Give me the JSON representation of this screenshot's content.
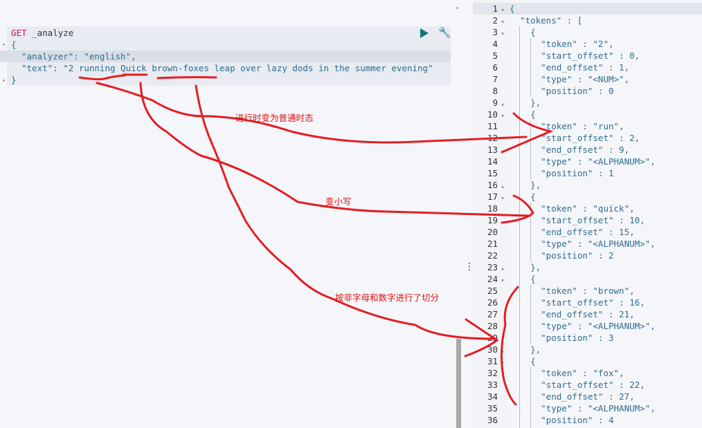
{
  "request": {
    "method": "GET",
    "endpoint": "_analyze",
    "lines": [
      "{",
      "  \"analyzer\": \"english\",",
      "  \"text\": \"2 running Quick brown-foxes leap over lazy dods in the summer evening\"",
      "}"
    ],
    "run_icon": "play-icon",
    "settings_icon": "wrench-icon"
  },
  "response": {
    "lines": [
      "{",
      "  \"tokens\" : [",
      "    {",
      "      \"token\" : \"2\",",
      "      \"start_offset\" : 0,",
      "      \"end_offset\" : 1,",
      "      \"type\" : \"<NUM>\",",
      "      \"position\" : 0",
      "    },",
      "    {",
      "      \"token\" : \"run\",",
      "      \"start_offset\" : 2,",
      "      \"end_offset\" : 9,",
      "      \"type\" : \"<ALPHANUM>\",",
      "      \"position\" : 1",
      "    },",
      "    {",
      "      \"token\" : \"quick\",",
      "      \"start_offset\" : 10,",
      "      \"end_offset\" : 15,",
      "      \"type\" : \"<ALPHANUM>\",",
      "      \"position\" : 2",
      "    },",
      "    {",
      "      \"token\" : \"brown\",",
      "      \"start_offset\" : 16,",
      "      \"end_offset\" : 21,",
      "      \"type\" : \"<ALPHANUM>\",",
      "      \"position\" : 3",
      "    },",
      "    {",
      "      \"token\" : \"fox\",",
      "      \"start_offset\" : 22,",
      "      \"end_offset\" : 27,",
      "      \"type\" : \"<ALPHANUM>\",",
      "      \"position\" : 4"
    ],
    "fold_open": [
      1,
      2,
      3,
      10,
      17,
      24,
      31
    ],
    "fold_close": [
      9,
      16,
      23,
      30
    ]
  },
  "annotations": {
    "tense": "进行时变为普通时态",
    "lowercase": "变小写",
    "split": "按非字母和数字进行了切分",
    "color": "#e01010"
  }
}
